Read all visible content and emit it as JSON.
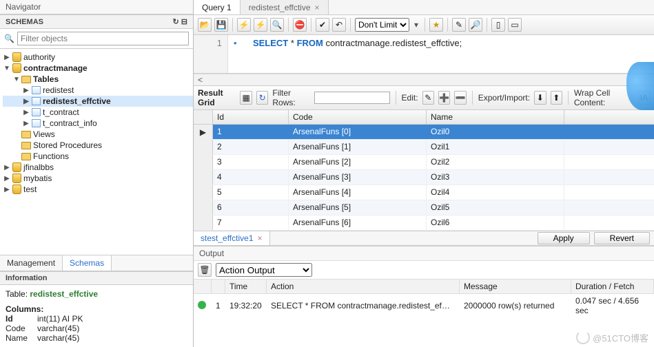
{
  "left": {
    "navigator_title": "Navigator",
    "schemas_title": "SCHEMAS",
    "filter_placeholder": "Filter objects",
    "tree": {
      "authority": "authority",
      "contractmanage": "contractmanage",
      "tables_label": "Tables",
      "tables": [
        "redistest",
        "redistest_effctive",
        "t_contract",
        "t_contract_info"
      ],
      "views": "Views",
      "stored_procedures": "Stored Procedures",
      "functions": "Functions",
      "jfinalbbs": "jfinalbbs",
      "mybatis": "mybatis",
      "test": "test"
    },
    "tabs": {
      "management": "Management",
      "schemas": "Schemas"
    },
    "info_title": "Information",
    "info": {
      "label": "Table:",
      "tablename": "redistest_effctive",
      "columns_label": "Columns:",
      "cols": [
        {
          "name": "Id",
          "type": "int(11) AI PK"
        },
        {
          "name": "Code",
          "type": "varchar(45)"
        },
        {
          "name": "Name",
          "type": "varchar(45)"
        }
      ]
    }
  },
  "tabs": {
    "query1": "Query 1",
    "active": "redistest_effctive"
  },
  "toolbar": {
    "limit_option": "Don't Limit"
  },
  "editor": {
    "line_no": "1",
    "kw_select": "SELECT",
    "star": " * ",
    "kw_from": "FROM",
    "ident": " contractmanage.redistest_effctive;",
    "bullet": "•"
  },
  "result": {
    "grid_label": "Result Grid",
    "filter_label": "Filter Rows:",
    "edit_label": "Edit:",
    "export_label": "Export/Import:",
    "wrap_label": "Wrap Cell Content:",
    "headers": {
      "id": "Id",
      "code": "Code",
      "name": "Name"
    },
    "rows": [
      {
        "id": "1",
        "code": "ArsenalFuns [0]",
        "name": "Ozil0"
      },
      {
        "id": "2",
        "code": "ArsenalFuns [1]",
        "name": "Ozil1"
      },
      {
        "id": "3",
        "code": "ArsenalFuns [2]",
        "name": "Ozil2"
      },
      {
        "id": "4",
        "code": "ArsenalFuns [3]",
        "name": "Ozil3"
      },
      {
        "id": "5",
        "code": "ArsenalFuns [4]",
        "name": "Ozil4"
      },
      {
        "id": "6",
        "code": "ArsenalFuns [5]",
        "name": "Ozil5"
      },
      {
        "id": "7",
        "code": "ArsenalFuns [6]",
        "name": "Ozil6"
      }
    ],
    "result_tab": "stest_effctive1",
    "apply": "Apply",
    "revert": "Revert"
  },
  "output": {
    "title": "Output",
    "selector": "Action Output",
    "head": {
      "time": "Time",
      "action": "Action",
      "message": "Message",
      "duration": "Duration / Fetch"
    },
    "row": {
      "num": "1",
      "time": "19:32:20",
      "action": "SELECT * FROM contractmanage.redistest_ef…",
      "message": "2000000 row(s) returned",
      "duration": "0.047 sec / 4.656 sec"
    }
  },
  "watermark": "@51CTO博客"
}
